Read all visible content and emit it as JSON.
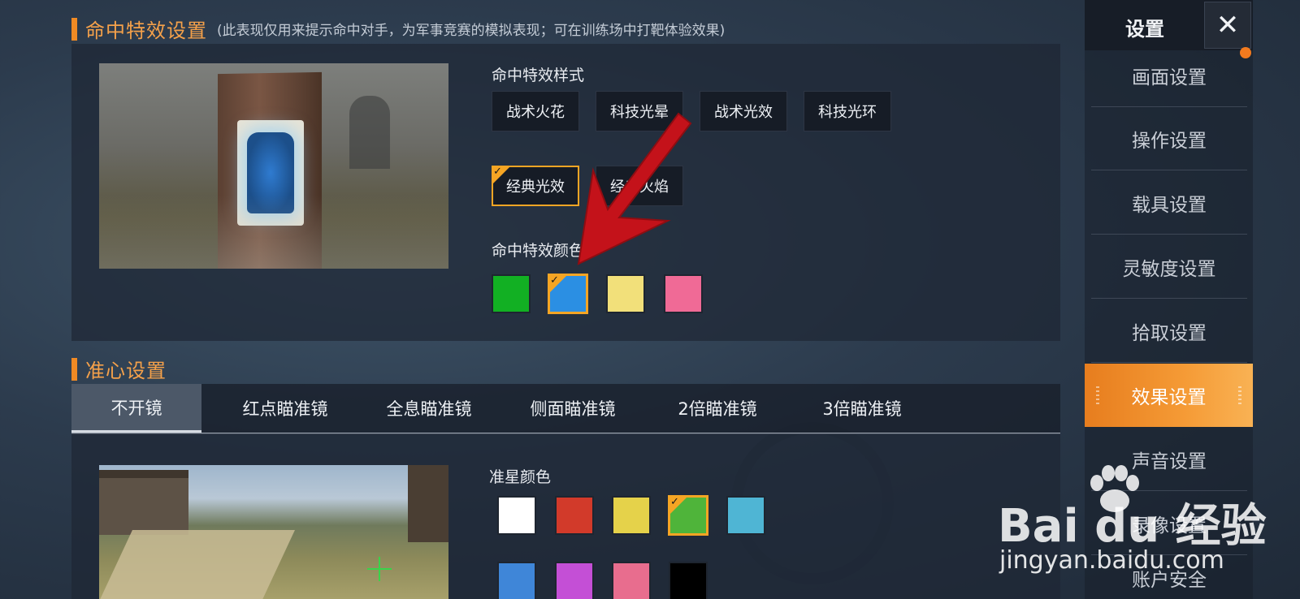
{
  "hit_section": {
    "title": "命中特效设置",
    "note": "(此表现仅用来提示命中对手，为军事竞赛的模拟表现；可在训练场中打靶体验效果)",
    "style_label": "命中特效样式",
    "styles": [
      "战术火花",
      "科技光晕",
      "战术光效",
      "科技光环",
      "经典光效",
      "经典火焰"
    ],
    "selected_style": "经典光效",
    "color_label": "命中特效颜色",
    "colors": [
      "#12b023",
      "#2b8fe3",
      "#f2e07a",
      "#f06a96"
    ],
    "selected_color_index": 1
  },
  "crosshair_section": {
    "title": "准心设置",
    "tabs": [
      "不开镜",
      "红点瞄准镜",
      "全息瞄准镜",
      "侧面瞄准镜",
      "2倍瞄准镜",
      "3倍瞄准镜"
    ],
    "active_tab": "不开镜",
    "color_label": "准星颜色",
    "colors": [
      "#ffffff",
      "#d23a2a",
      "#e5d24a",
      "#4fb43a",
      "#4fb5d4",
      "#3f86d8",
      "#c44fd6",
      "#e86d8e",
      "#000000"
    ],
    "selected_color_index": 3
  },
  "sidebar": {
    "title": "设置",
    "items": [
      "画面设置",
      "操作设置",
      "载具设置",
      "灵敏度设置",
      "拾取设置",
      "效果设置",
      "声音设置",
      "录像设置",
      "账户安全"
    ],
    "active_item": "效果设置"
  },
  "watermark": {
    "brand": "Bai du 经验",
    "url": "jingyan.baidu.com"
  },
  "icons": {
    "close": "close-icon",
    "check": "checkmark-icon"
  },
  "colors": {
    "accent": "#f5a524",
    "title_orange": "#f5a14a",
    "annotation_arrow": "#c4121a"
  }
}
